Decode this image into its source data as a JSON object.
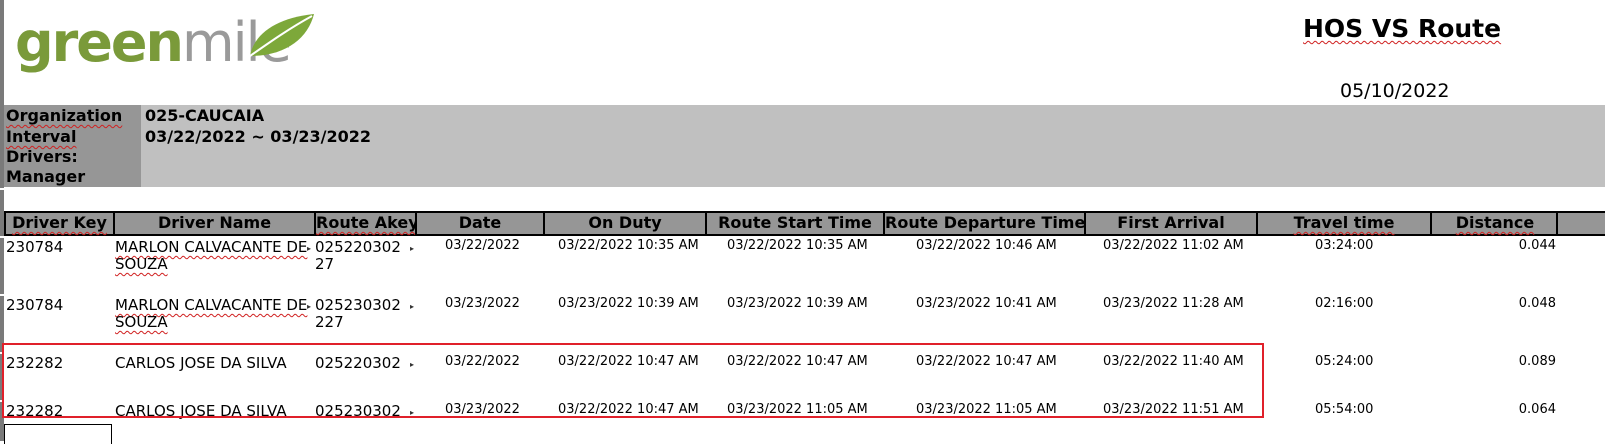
{
  "logo": {
    "part1": "green",
    "part2": "mile"
  },
  "report": {
    "title": "HOS VS Route",
    "date": "05/10/2022"
  },
  "info": {
    "organization_label": "Organization",
    "organization_value": "025-CAUCAIA",
    "interval_label": "Interval",
    "interval_value": "03/22/2022 ~ 03/23/2022",
    "drivers_label": "Drivers:",
    "manager_label": "Manager"
  },
  "table": {
    "headers": [
      "Driver Key",
      "Driver Name",
      "Route Akey",
      "Date",
      "On Duty",
      "Route Start Time",
      "Route Departure Time",
      "First Arrival",
      "Travel time",
      "Distance"
    ],
    "rows": [
      {
        "driver_key": "230784",
        "driver_name_l1": "MARLON CALVACANTE DE",
        "driver_name_l2": "SOUZA",
        "route_akey_l1": "025220302",
        "route_akey_l2": "27",
        "date": "03/22/2022",
        "on_duty": "03/22/2022 10:35 AM",
        "route_start": "03/22/2022 10:35 AM",
        "route_departure": "03/22/2022 10:46 AM",
        "first_arrival": "03/22/2022 11:02 AM",
        "travel_time": "03:24:00",
        "distance": "0.044"
      },
      {
        "driver_key": "230784",
        "driver_name_l1": "MARLON CALVACANTE DE",
        "driver_name_l2": "SOUZA",
        "route_akey_l1": "025230302",
        "route_akey_l2": "227",
        "date": "03/23/2022",
        "on_duty": "03/23/2022 10:39 AM",
        "route_start": "03/23/2022 10:39 AM",
        "route_departure": "03/23/2022 10:41 AM",
        "first_arrival": "03/23/2022 11:28 AM",
        "travel_time": "02:16:00",
        "distance": "0.048"
      },
      {
        "driver_key": "232282",
        "driver_name_l1": "CARLOS JOSE DA SILVA",
        "driver_name_l2": "",
        "route_akey_l1": "025220302",
        "route_akey_l2": "",
        "date": "03/22/2022",
        "on_duty": "03/22/2022 10:47 AM",
        "route_start": "03/22/2022 10:47 AM",
        "route_departure": "03/22/2022 10:47 AM",
        "first_arrival": "03/22/2022 11:40 AM",
        "travel_time": "05:24:00",
        "distance": "0.089"
      },
      {
        "driver_key": "232282",
        "driver_name_l1": "CARLOS JOSE DA SILVA",
        "driver_name_l2": "",
        "route_akey_l1": "025230302",
        "route_akey_l2": "",
        "date": "03/23/2022",
        "on_duty": "03/22/2022 10:47 AM",
        "route_start": "03/23/2022 11:05 AM",
        "route_departure": "03/23/2022 11:05 AM",
        "first_arrival": "03/23/2022 11:51 AM",
        "travel_time": "05:54:00",
        "distance": "0.064"
      }
    ]
  },
  "colors": {
    "header_bg": "#969696",
    "band_bg": "#c0c0c0",
    "highlight_border": "#e0202a",
    "logo_green": "#7a9a3a"
  }
}
